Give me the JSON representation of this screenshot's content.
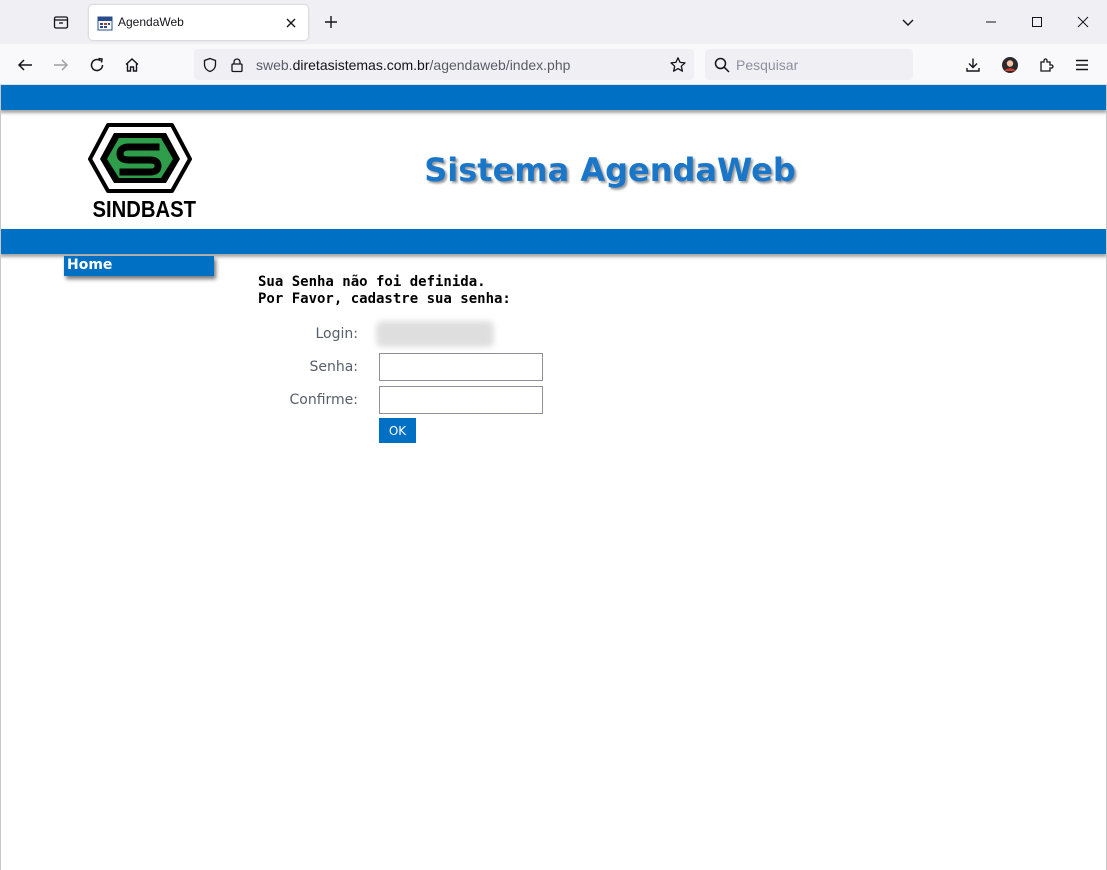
{
  "browser": {
    "tab": {
      "title": "AgendaWeb"
    },
    "url": {
      "prefix": "sweb.",
      "domain": "diretasistemas.com.br",
      "path": "/agendaweb/index.php"
    },
    "search": {
      "placeholder": "Pesquisar"
    }
  },
  "header": {
    "logo_text": "SINDBAST",
    "title": "Sistema AgendaWeb"
  },
  "menu": {
    "home_label": "Home"
  },
  "form": {
    "message_line1": "Sua Senha não foi definida.",
    "message_line2": "Por Favor, cadastre sua senha:",
    "login_label": "Login:",
    "login_value": "",
    "senha_label": "Senha:",
    "confirme_label": "Confirme:",
    "ok_label": "OK"
  },
  "colors": {
    "accent": "#0070c4",
    "title": "#1976c8",
    "logo_green": "#2e9e4a"
  }
}
